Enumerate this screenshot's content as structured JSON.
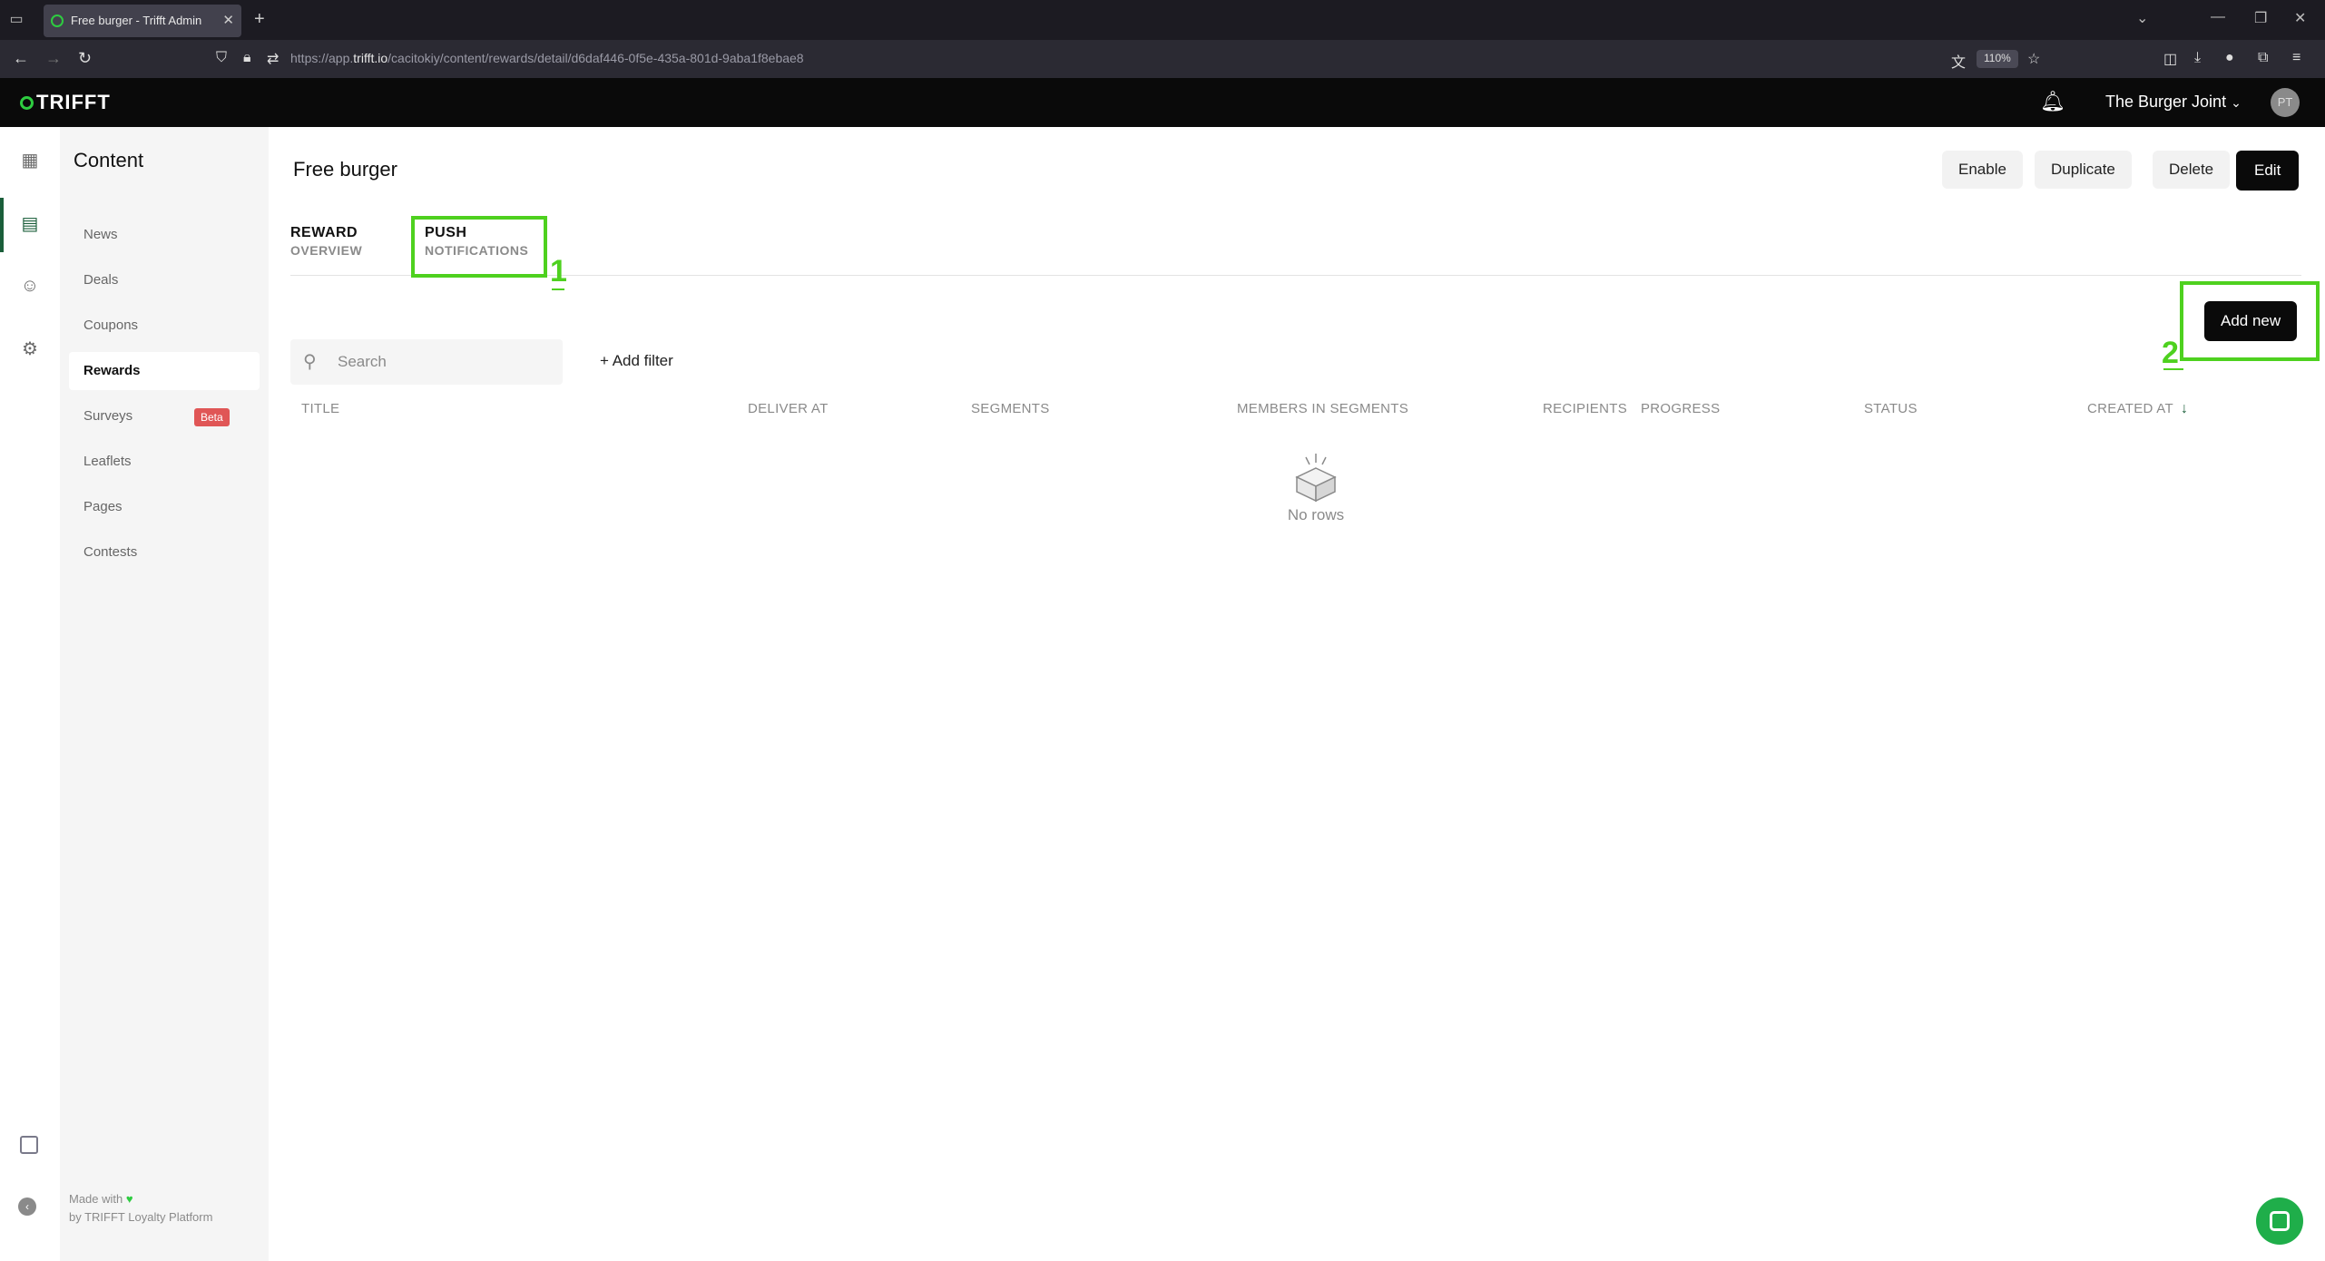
{
  "browser": {
    "tab_title": "Free burger - Trifft Admin",
    "url_prefix": "https://app.",
    "url_domain": "trifft.io",
    "url_path": "/cacitokiy/content/rewards/detail/d6daf446-0f5e-435a-801d-9aba1f8ebae8",
    "zoom": "110%"
  },
  "app": {
    "logo": "TRIFFT",
    "org_name": "The Burger Joint",
    "avatar_initials": "PT"
  },
  "sidebar": {
    "title": "Content",
    "items": [
      {
        "label": "News"
      },
      {
        "label": "Deals"
      },
      {
        "label": "Coupons"
      },
      {
        "label": "Rewards"
      },
      {
        "label": "Surveys",
        "badge": "Beta"
      },
      {
        "label": "Leaflets"
      },
      {
        "label": "Pages"
      },
      {
        "label": "Contests"
      }
    ],
    "footer_line1": "Made with",
    "footer_line2": "by TRIFFT Loyalty Platform"
  },
  "page": {
    "title": "Free burger",
    "buttons": {
      "enable": "Enable",
      "duplicate": "Duplicate",
      "delete": "Delete",
      "edit": "Edit"
    },
    "tabs": [
      {
        "line1": "REWARD",
        "line2": "OVERVIEW"
      },
      {
        "line1": "PUSH",
        "line2": "NOTIFICATIONS"
      }
    ],
    "add_new": "Add new",
    "search_placeholder": "Search",
    "add_filter": "+ Add filter",
    "columns": [
      "TITLE",
      "DELIVER AT",
      "SEGMENTS",
      "MEMBERS IN SEGMENTS",
      "RECIPIENTS",
      "PROGRESS",
      "STATUS",
      "CREATED AT"
    ],
    "empty_text": "No rows"
  },
  "annotations": {
    "one": "1",
    "two": "2"
  },
  "colors": {
    "accent_green": "#4ed11f",
    "brand_dark": "#0a0a0a",
    "active_green": "#1a5e3a",
    "beta_red": "#e05656"
  }
}
